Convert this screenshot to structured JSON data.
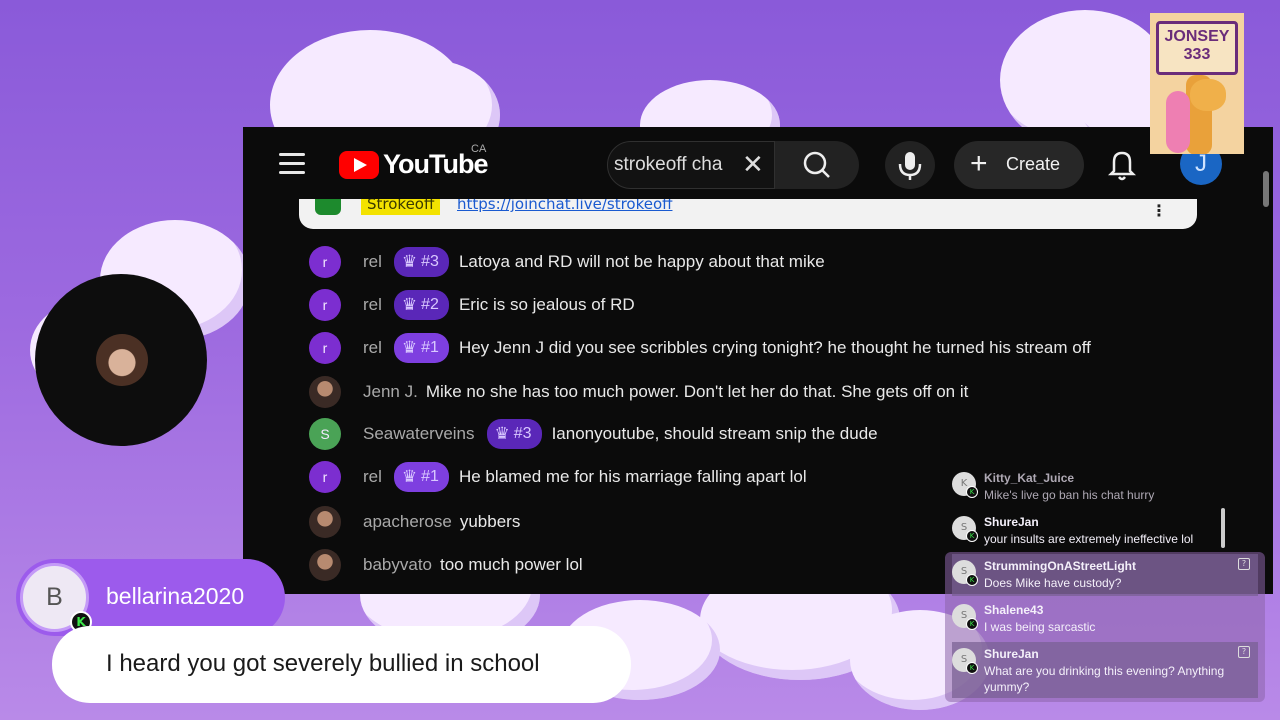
{
  "youtube": {
    "logo_text": "YouTube",
    "country_code": "CA",
    "search_value": "strokeoff cha",
    "create_label": "Create",
    "avatar_letter": "J",
    "pinned": {
      "name": "Strokeoff",
      "link": "https://joinchat.live/strokeoff"
    },
    "messages": [
      {
        "avatar": "r",
        "avatar_style": "purple",
        "user": "rel",
        "badge": "#3",
        "text": "Latoya and RD will not be happy about that mike"
      },
      {
        "avatar": "r",
        "avatar_style": "purple",
        "user": "rel",
        "badge": "#2",
        "text": "Eric is so jealous of RD"
      },
      {
        "avatar": "r",
        "avatar_style": "purple",
        "user": "rel",
        "badge": "#1",
        "text": "Hey Jenn J did you see scribbles crying tonight? he thought he turned his stream off"
      },
      {
        "avatar": "",
        "avatar_style": "photo",
        "user": "Jenn J.",
        "badge": "",
        "text": "Mike no she has too much power. Don't let her do that. She gets off on it"
      },
      {
        "avatar": "S",
        "avatar_style": "green",
        "user": "Seawaterveins",
        "badge": "#3",
        "text": "Ianonyoutube, should stream snip the dude"
      },
      {
        "avatar": "r",
        "avatar_style": "purple",
        "user": "rel",
        "badge": "#1",
        "text": "He blamed me for his marriage falling apart lol"
      },
      {
        "avatar": "",
        "avatar_style": "photo",
        "user": "apacherose",
        "badge": "",
        "text": "yubbers"
      },
      {
        "avatar": "",
        "avatar_style": "photo",
        "user": "babyvato",
        "badge": "",
        "text": "too much power lol"
      }
    ]
  },
  "sticker": {
    "line1": "JONSEY",
    "line2": "333"
  },
  "featured": {
    "avatar_letter": "B",
    "badge_letter": "K",
    "username": "bellarina2020",
    "message": "I heard you got severely bullied in school"
  },
  "kick_chat": [
    {
      "user": "Kitty_Kat_Juice",
      "text": "Mike's live go ban his chat hurry",
      "avatar": "K",
      "style": "dim"
    },
    {
      "user": "ShureJan",
      "text": "your insults are extremely ineffective lol",
      "avatar": "S",
      "style": ""
    },
    {
      "user": "StrummingOnAStreetLight",
      "text": "Does Mike have custody?",
      "avatar": "S",
      "style": "hl"
    },
    {
      "user": "Shalene43",
      "text": "I was being sarcastic",
      "avatar": "S",
      "style": ""
    },
    {
      "user": "ShureJan",
      "text": "What are you drinking this evening? Anything yummy?",
      "avatar": "S",
      "style": "hl"
    }
  ],
  "colors": {
    "accent": "#9c5bec",
    "youtube_red": "#ff0000",
    "kick_green": "#3ce84a"
  }
}
